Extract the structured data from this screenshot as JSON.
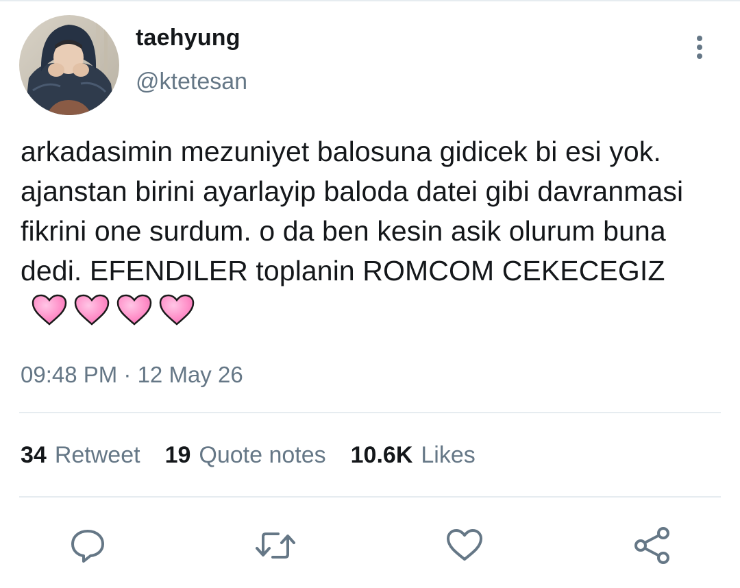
{
  "tweet": {
    "display_name": "taehyung",
    "handle": "@ktetesan",
    "text": "arkadasimin mezuniyet balosuna gidicek bi esi yok. ajanstan birini ayarlayip baloda datei gibi davranmasi fikrini one surdum. o da ben kesin asik olurum buna dedi. EFENDILER toplanin ROMCOM CEKECEGIZ",
    "emoji": [
      "pink-heart",
      "pink-heart",
      "pink-heart",
      "pink-heart"
    ],
    "timestamp": "09:48 PM · 12 May 26"
  },
  "stats": {
    "retweets_count": "34",
    "retweets_label": "Retweet",
    "quotes_count": "19",
    "quotes_label": "Quote notes",
    "likes_count": "10.6K",
    "likes_label": "Likes"
  },
  "icons": {
    "more": "more-vertical-icon",
    "reply": "reply-icon",
    "retweet": "retweet-icon",
    "like": "heart-icon",
    "share": "share-icon"
  },
  "colors": {
    "primary_text": "#14171a",
    "secondary_text": "#657786",
    "divider": "#e6ecf0",
    "heart_emoji": "#ff8fc8"
  }
}
